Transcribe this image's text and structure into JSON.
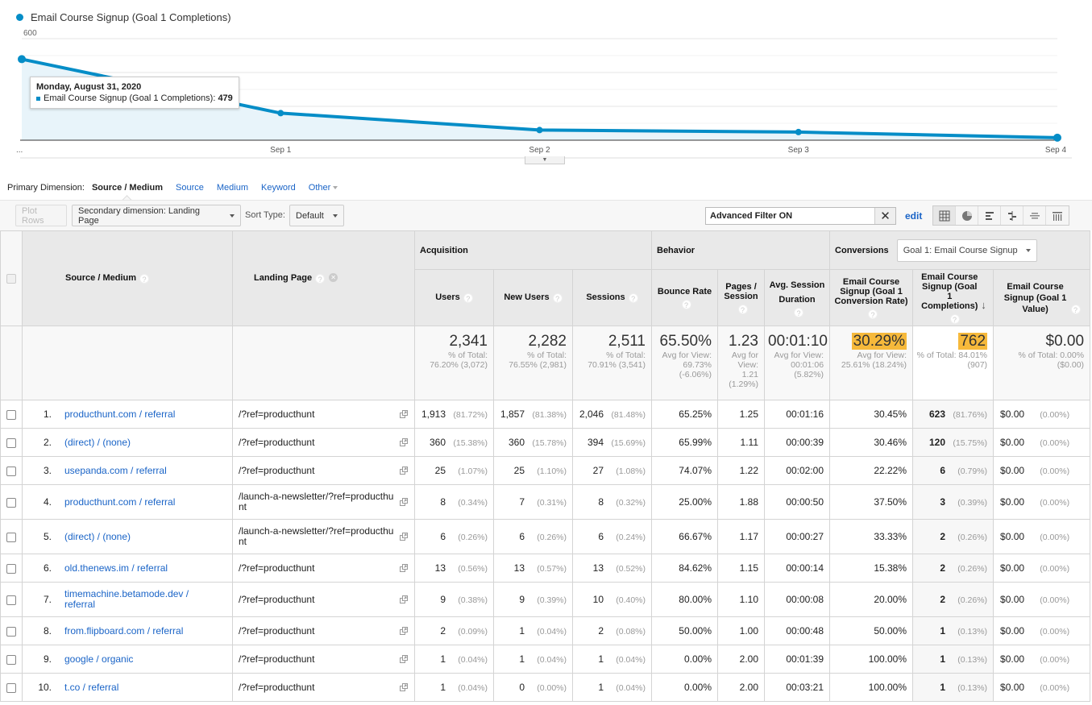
{
  "chart": {
    "legend_label": "Email Course Signup (Goal 1 Completions)",
    "tooltip": {
      "date": "Monday, August 31, 2020",
      "metric_label": "Email Course Signup (Goal 1 Completions):",
      "value": "479"
    },
    "series_color": "#058dc7"
  },
  "chart_data": {
    "type": "line",
    "title": "",
    "legend": [
      "Email Course Signup (Goal 1 Completions)"
    ],
    "x": [
      "Aug 31",
      "Sep 1",
      "Sep 2",
      "Sep 3",
      "Sep 4"
    ],
    "x_tick_labels": [
      "...",
      "Sep 1",
      "Sep 2",
      "Sep 3",
      "Sep 4"
    ],
    "series": [
      {
        "name": "Email Course Signup (Goal 1 Completions)",
        "values": [
          479,
          160,
          60,
          48,
          15
        ]
      }
    ],
    "y_ticks": [
      200,
      400,
      600
    ],
    "ylim": [
      0,
      600
    ],
    "grid": true,
    "area_fill": true,
    "xlabel": "",
    "ylabel": ""
  },
  "primary_dimension": {
    "label": "Primary Dimension:",
    "active": "Source / Medium",
    "links": [
      "Source",
      "Medium",
      "Keyword",
      "Other"
    ]
  },
  "toolbar": {
    "plot_rows": "Plot Rows",
    "secondary_dimension": "Secondary dimension: Landing Page",
    "sort_type_label": "Sort Type:",
    "sort_type_value": "Default",
    "filter_text": "Advanced Filter ON",
    "filter_clear": "✕",
    "edit": "edit",
    "view_icons": [
      "table-view-icon",
      "pie-view-icon",
      "bar-view-icon",
      "comparison-view-icon",
      "term-cloud-icon",
      "pivot-view-icon"
    ]
  },
  "table": {
    "groups": {
      "acquisition": "Acquisition",
      "behavior": "Behavior",
      "conversions": "Conversions",
      "goal_select": "Goal 1: Email Course Signup"
    },
    "columns": {
      "source_medium": "Source / Medium",
      "landing_page": "Landing Page",
      "users": "Users",
      "new_users": "New Users",
      "sessions": "Sessions",
      "bounce_rate": "Bounce Rate",
      "pages_session": "Pages / Session",
      "avg_session_duration": "Avg. Session Duration",
      "conv_rate": "Email Course Signup (Goal 1 Conversion Rate)",
      "completions": "Email Course Signup (Goal 1 Completions)",
      "value": "Email Course Signup (Goal 1 Value)"
    },
    "totals": {
      "users": {
        "value": "2,341",
        "sub": "% of Total: 76.20% (3,072)"
      },
      "new_users": {
        "value": "2,282",
        "sub": "% of Total: 76.55% (2,981)"
      },
      "sessions": {
        "value": "2,511",
        "sub": "% of Total: 70.91% (3,541)"
      },
      "bounce_rate": {
        "value": "65.50%",
        "sub": "Avg for View: 69.73% (-6.06%)"
      },
      "pages_session": {
        "value": "1.23",
        "sub": "Avg for View: 1.21 (1.29%)"
      },
      "avg_session_duration": {
        "value": "00:01:10",
        "sub": "Avg for View: 00:01:06 (5.82%)"
      },
      "conv_rate": {
        "value": "30.29%",
        "sub": "Avg for View: 25.61% (18.24%)"
      },
      "completions": {
        "value": "762",
        "sub": "% of Total: 84.01% (907)"
      },
      "value": {
        "value": "$0.00",
        "sub": "% of Total: 0.00% ($0.00)"
      }
    },
    "rows": [
      {
        "idx": "1.",
        "source": "producthunt.com / referral",
        "landing": "/?ref=producthunt",
        "users": "1,913",
        "users_pct": "(81.72%)",
        "new_users": "1,857",
        "new_users_pct": "(81.38%)",
        "sessions": "2,046",
        "sessions_pct": "(81.48%)",
        "bounce": "65.25%",
        "pps": "1.25",
        "dur": "00:01:16",
        "conv_rate": "30.45%",
        "comp": "623",
        "comp_pct": "(81.76%)",
        "value": "$0.00",
        "value_pct": "(0.00%)"
      },
      {
        "idx": "2.",
        "source": "(direct) / (none)",
        "landing": "/?ref=producthunt",
        "users": "360",
        "users_pct": "(15.38%)",
        "new_users": "360",
        "new_users_pct": "(15.78%)",
        "sessions": "394",
        "sessions_pct": "(15.69%)",
        "bounce": "65.99%",
        "pps": "1.11",
        "dur": "00:00:39",
        "conv_rate": "30.46%",
        "comp": "120",
        "comp_pct": "(15.75%)",
        "value": "$0.00",
        "value_pct": "(0.00%)"
      },
      {
        "idx": "3.",
        "source": "usepanda.com / referral",
        "landing": "/?ref=producthunt",
        "users": "25",
        "users_pct": "(1.07%)",
        "new_users": "25",
        "new_users_pct": "(1.10%)",
        "sessions": "27",
        "sessions_pct": "(1.08%)",
        "bounce": "74.07%",
        "pps": "1.22",
        "dur": "00:02:00",
        "conv_rate": "22.22%",
        "comp": "6",
        "comp_pct": "(0.79%)",
        "value": "$0.00",
        "value_pct": "(0.00%)"
      },
      {
        "idx": "4.",
        "source": "producthunt.com / referral",
        "landing": "/launch-a-newsletter/?ref=producthunt",
        "users": "8",
        "users_pct": "(0.34%)",
        "new_users": "7",
        "new_users_pct": "(0.31%)",
        "sessions": "8",
        "sessions_pct": "(0.32%)",
        "bounce": "25.00%",
        "pps": "1.88",
        "dur": "00:00:50",
        "conv_rate": "37.50%",
        "comp": "3",
        "comp_pct": "(0.39%)",
        "value": "$0.00",
        "value_pct": "(0.00%)"
      },
      {
        "idx": "5.",
        "source": "(direct) / (none)",
        "landing": "/launch-a-newsletter/?ref=producthunt",
        "users": "6",
        "users_pct": "(0.26%)",
        "new_users": "6",
        "new_users_pct": "(0.26%)",
        "sessions": "6",
        "sessions_pct": "(0.24%)",
        "bounce": "66.67%",
        "pps": "1.17",
        "dur": "00:00:27",
        "conv_rate": "33.33%",
        "comp": "2",
        "comp_pct": "(0.26%)",
        "value": "$0.00",
        "value_pct": "(0.00%)"
      },
      {
        "idx": "6.",
        "source": "old.thenews.im / referral",
        "landing": "/?ref=producthunt",
        "users": "13",
        "users_pct": "(0.56%)",
        "new_users": "13",
        "new_users_pct": "(0.57%)",
        "sessions": "13",
        "sessions_pct": "(0.52%)",
        "bounce": "84.62%",
        "pps": "1.15",
        "dur": "00:00:14",
        "conv_rate": "15.38%",
        "comp": "2",
        "comp_pct": "(0.26%)",
        "value": "$0.00",
        "value_pct": "(0.00%)"
      },
      {
        "idx": "7.",
        "source": "timemachine.betamode.dev / referral",
        "landing": "/?ref=producthunt",
        "users": "9",
        "users_pct": "(0.38%)",
        "new_users": "9",
        "new_users_pct": "(0.39%)",
        "sessions": "10",
        "sessions_pct": "(0.40%)",
        "bounce": "80.00%",
        "pps": "1.10",
        "dur": "00:00:08",
        "conv_rate": "20.00%",
        "comp": "2",
        "comp_pct": "(0.26%)",
        "value": "$0.00",
        "value_pct": "(0.00%)"
      },
      {
        "idx": "8.",
        "source": "from.flipboard.com / referral",
        "landing": "/?ref=producthunt",
        "users": "2",
        "users_pct": "(0.09%)",
        "new_users": "1",
        "new_users_pct": "(0.04%)",
        "sessions": "2",
        "sessions_pct": "(0.08%)",
        "bounce": "50.00%",
        "pps": "1.00",
        "dur": "00:00:48",
        "conv_rate": "50.00%",
        "comp": "1",
        "comp_pct": "(0.13%)",
        "value": "$0.00",
        "value_pct": "(0.00%)"
      },
      {
        "idx": "9.",
        "source": "google / organic",
        "landing": "/?ref=producthunt",
        "users": "1",
        "users_pct": "(0.04%)",
        "new_users": "1",
        "new_users_pct": "(0.04%)",
        "sessions": "1",
        "sessions_pct": "(0.04%)",
        "bounce": "0.00%",
        "pps": "2.00",
        "dur": "00:01:39",
        "conv_rate": "100.00%",
        "comp": "1",
        "comp_pct": "(0.13%)",
        "value": "$0.00",
        "value_pct": "(0.00%)"
      },
      {
        "idx": "10.",
        "source": "t.co / referral",
        "landing": "/?ref=producthunt",
        "users": "1",
        "users_pct": "(0.04%)",
        "new_users": "0",
        "new_users_pct": "(0.00%)",
        "sessions": "1",
        "sessions_pct": "(0.04%)",
        "bounce": "0.00%",
        "pps": "2.00",
        "dur": "00:03:21",
        "conv_rate": "100.00%",
        "comp": "1",
        "comp_pct": "(0.13%)",
        "value": "$0.00",
        "value_pct": "(0.00%)"
      }
    ]
  }
}
